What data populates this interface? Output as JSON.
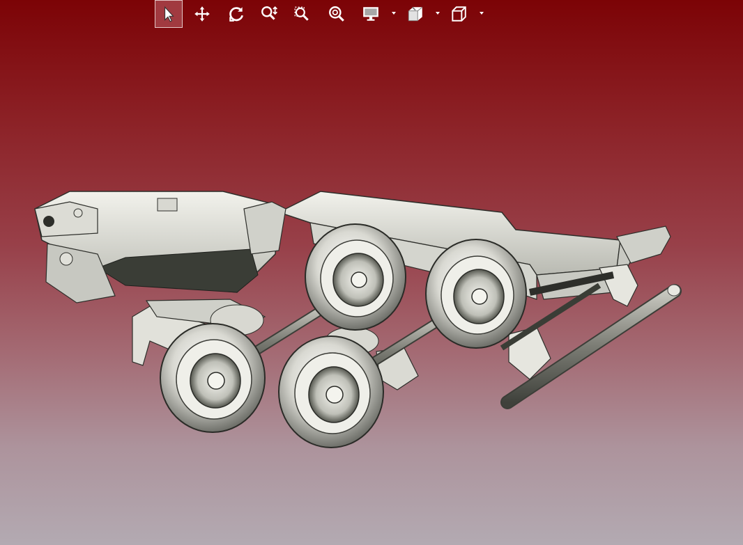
{
  "app": {
    "background_top": "#7c0306",
    "background_bottom": "#b3aab2",
    "accent": "#a13a40"
  },
  "toolbar": {
    "buttons": [
      {
        "name": "select-tool",
        "icon": "arrow-cursor-icon",
        "active": true
      },
      {
        "name": "pan-tool",
        "icon": "move-arrows-icon",
        "active": false
      },
      {
        "name": "rotate-tool",
        "icon": "rotate-icon",
        "active": false
      },
      {
        "name": "zoom-tool",
        "icon": "zoom-icon",
        "active": false
      },
      {
        "name": "zoom-window-tool",
        "icon": "zoom-window-icon",
        "active": false
      },
      {
        "name": "zoom-fit-tool",
        "icon": "zoom-fit-icon",
        "active": false
      },
      {
        "name": "display-mode-dropdown",
        "icon": "monitor-icon",
        "active": false
      },
      {
        "name": "section-view-dropdown",
        "icon": "section-cube-icon",
        "active": false
      },
      {
        "name": "view-orientation-dropdown",
        "icon": "cube-icon",
        "active": false
      }
    ]
  },
  "model": {
    "description_color_body": "#e9e9e2",
    "description_color_shadow": "#3a3d36"
  }
}
